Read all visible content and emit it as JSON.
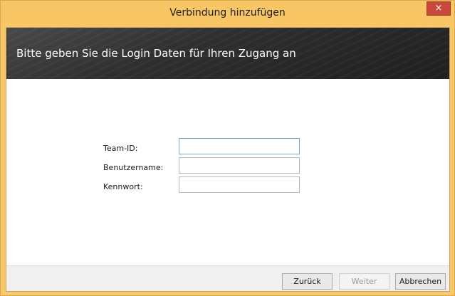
{
  "window": {
    "title": "Verbindung hinzufügen",
    "close_glyph": "×"
  },
  "banner": {
    "text": "Bitte geben Sie die Login Daten für Ihren Zugang an"
  },
  "form": {
    "fields": [
      {
        "label": "Team-ID:",
        "value": "",
        "focused": true
      },
      {
        "label": "Benutzername:",
        "value": "",
        "focused": false
      },
      {
        "label": "Kennwort:",
        "value": "",
        "focused": false
      }
    ]
  },
  "buttons": {
    "back": "Zurück",
    "next": "Weiter",
    "cancel": "Abbrechen"
  },
  "colors": {
    "titlebar": "#f8c665",
    "close_button": "#c9473b",
    "banner": "#2f2f2f",
    "focus_border": "#7da7d8"
  }
}
